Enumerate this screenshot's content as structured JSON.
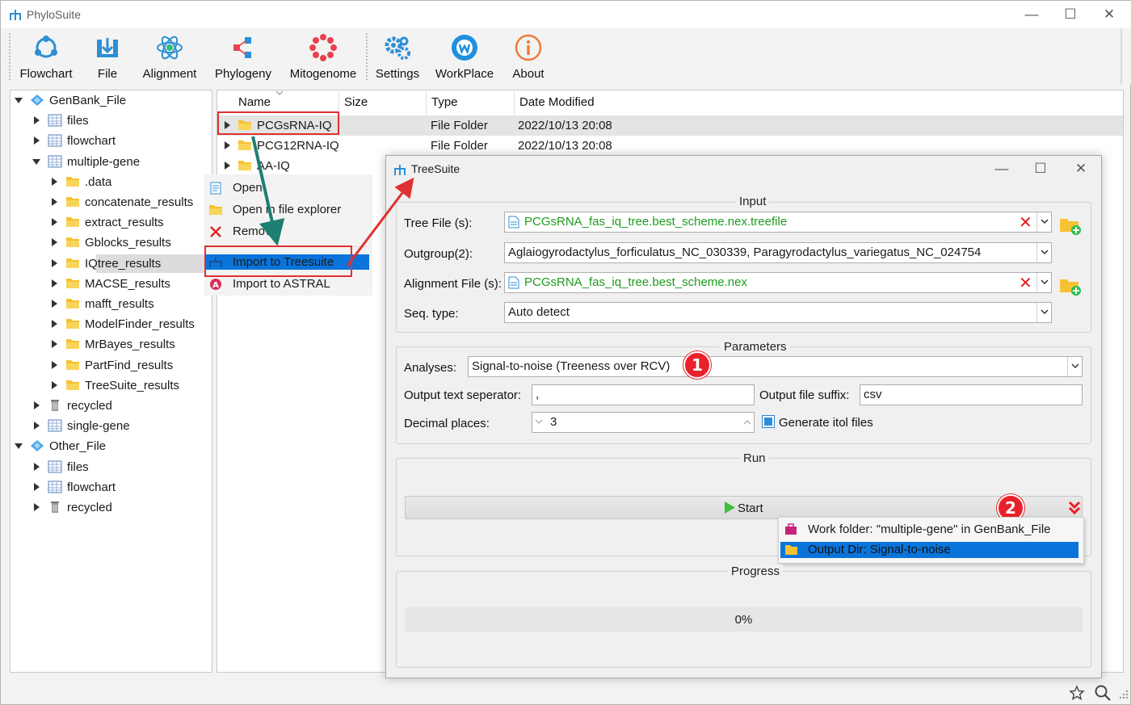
{
  "app": {
    "title": "PhyloSuite",
    "window_controls": {
      "minimize": "—",
      "maximize": "☐",
      "close": "✕"
    }
  },
  "toolbar": {
    "items": [
      {
        "label": "Flowchart",
        "icon": "flowchart-icon"
      },
      {
        "label": "File",
        "icon": "file-icon"
      },
      {
        "label": "Alignment",
        "icon": "alignment-icon"
      },
      {
        "label": "Phylogeny",
        "icon": "phylogeny-icon"
      },
      {
        "label": "Mitogenome",
        "icon": "mitogenome-icon"
      },
      {
        "label": "Settings",
        "icon": "settings-icon"
      },
      {
        "label": "WorkPlace",
        "icon": "workplace-icon"
      },
      {
        "label": "About",
        "icon": "about-icon"
      }
    ]
  },
  "tree": {
    "items": [
      {
        "label": "GenBank_File",
        "level": 0,
        "expanded": true,
        "icon": "workspace-icon"
      },
      {
        "label": "files",
        "level": 1,
        "expanded": false,
        "icon": "table-icon"
      },
      {
        "label": "flowchart",
        "level": 1,
        "expanded": false,
        "icon": "table-icon"
      },
      {
        "label": "multiple-gene",
        "level": 1,
        "expanded": true,
        "icon": "table-icon"
      },
      {
        "label": ".data",
        "level": 2,
        "expanded": false,
        "icon": "folder-icon"
      },
      {
        "label": "concatenate_results",
        "level": 2,
        "expanded": false,
        "icon": "folder-icon"
      },
      {
        "label": "extract_results",
        "level": 2,
        "expanded": false,
        "icon": "folder-icon"
      },
      {
        "label": "Gblocks_results",
        "level": 2,
        "expanded": false,
        "icon": "folder-icon"
      },
      {
        "label": "IQtree_results",
        "level": 2,
        "expanded": false,
        "icon": "folder-icon",
        "selected": true
      },
      {
        "label": "MACSE_results",
        "level": 2,
        "expanded": false,
        "icon": "folder-icon"
      },
      {
        "label": "mafft_results",
        "level": 2,
        "expanded": false,
        "icon": "folder-icon"
      },
      {
        "label": "ModelFinder_results",
        "level": 2,
        "expanded": false,
        "icon": "folder-icon"
      },
      {
        "label": "MrBayes_results",
        "level": 2,
        "expanded": false,
        "icon": "folder-icon"
      },
      {
        "label": "PartFind_results",
        "level": 2,
        "expanded": false,
        "icon": "folder-icon"
      },
      {
        "label": "TreeSuite_results",
        "level": 2,
        "expanded": false,
        "icon": "folder-icon"
      },
      {
        "label": "recycled",
        "level": 1,
        "expanded": false,
        "icon": "trash-icon"
      },
      {
        "label": "single-gene",
        "level": 1,
        "expanded": false,
        "icon": "table-icon"
      },
      {
        "label": "Other_File",
        "level": 0,
        "expanded": true,
        "icon": "workspace-icon"
      },
      {
        "label": "files",
        "level": 1,
        "expanded": false,
        "icon": "table-icon"
      },
      {
        "label": "flowchart",
        "level": 1,
        "expanded": false,
        "icon": "table-icon"
      },
      {
        "label": "recycled",
        "level": 1,
        "expanded": false,
        "icon": "trash-icon"
      }
    ]
  },
  "file_list": {
    "columns": [
      "Name",
      "Size",
      "Type",
      "Date Modified"
    ],
    "rows": [
      {
        "name": "PCGsRNA-IQ",
        "size": "",
        "type": "File Folder",
        "date": "2022/10/13 20:08"
      },
      {
        "name": "PCG12RNA-IQ",
        "size": "",
        "type": "File Folder",
        "date": "2022/10/13 20:08"
      },
      {
        "name": "AA-IQ",
        "size": "",
        "type": "",
        "date": ""
      }
    ]
  },
  "context_menu": {
    "items": [
      {
        "label": "Open",
        "icon": "open-icon"
      },
      {
        "label": "Open in file explorer",
        "icon": "folder-icon"
      },
      {
        "label": "Remove",
        "icon": "remove-icon"
      },
      {
        "label": "Import to Treesuite",
        "icon": "treesuite-icon",
        "highlighted": true
      },
      {
        "label": "Import to ASTRAL",
        "icon": "astral-icon"
      }
    ]
  },
  "dialog": {
    "title": "TreeSuite",
    "input": {
      "group_title": "Input",
      "tree_file_label": "Tree File (s):",
      "tree_file_value": "PCGsRNA_fas_iq_tree.best_scheme.nex.treefile",
      "outgroup_label": "Outgroup(2):",
      "outgroup_value": "Aglaiogyrodactylus_forficulatus_NC_030339, Paragyrodactylus_variegatus_NC_024754",
      "alignment_label": "Alignment File (s):",
      "alignment_value": "PCGsRNA_fas_iq_tree.best_scheme.nex",
      "seqtype_label": "Seq. type:",
      "seqtype_value": "Auto detect",
      "clear_symbol": "✕"
    },
    "parameters": {
      "group_title": "Parameters",
      "analyses_label": "Analyses:",
      "analyses_value": "Signal-to-noise (Treeness over RCV)",
      "separator_label": "Output text seperator:",
      "separator_value": ",",
      "suffix_label": "Output file suffix:",
      "suffix_value": "csv",
      "decimal_label": "Decimal places:",
      "decimal_value": "3",
      "itol_label": "Generate itol files",
      "itol_checked": true
    },
    "run": {
      "group_title": "Run",
      "start_label": "Start",
      "dropdown_items": [
        {
          "label": "Work folder: \"multiple-gene\" in GenBank_File",
          "icon": "briefcase-icon"
        },
        {
          "label": "Output Dir: Signal-to-noise",
          "icon": "folder-icon",
          "highlighted": true
        }
      ]
    },
    "progress": {
      "group_title": "Progress",
      "value_text": "0%",
      "value": 0
    },
    "badges": [
      "1",
      "2"
    ]
  },
  "colors": {
    "accent": "#0a74da",
    "highlight_red": "#e03030",
    "green_text": "#1e9b1e",
    "folder_yellow": "#f6c232"
  }
}
